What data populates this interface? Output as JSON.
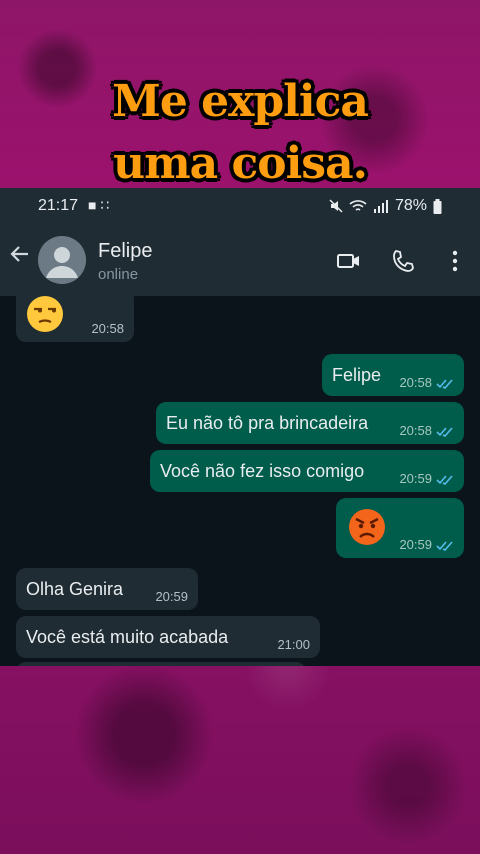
{
  "caption": {
    "line1": "Me explica",
    "line2": "uma coisa."
  },
  "statusbar": {
    "time": "21:17",
    "battery": "78%"
  },
  "header": {
    "name": "Felipe",
    "status": "online"
  },
  "messages": [
    {
      "dir": "in",
      "text": "",
      "emoji": "unamused-face",
      "time": "20:58"
    },
    {
      "dir": "out",
      "text": "Felipe",
      "time": "20:58",
      "read": true
    },
    {
      "dir": "out",
      "text": "Eu não tô pra brincadeira",
      "time": "20:58",
      "read": true
    },
    {
      "dir": "out",
      "text": "Você não fez isso comigo",
      "time": "20:59",
      "read": true
    },
    {
      "dir": "out",
      "text": "",
      "emoji": "angry-face",
      "time": "20:59",
      "read": true
    },
    {
      "dir": "in",
      "text": "Olha Genira",
      "time": "20:59"
    },
    {
      "dir": "in",
      "text": "Você está muito acabada",
      "time": "21:00"
    }
  ],
  "colors": {
    "tick_read": "#53bdeb",
    "bubble_out": "#005c4b",
    "bubble_in": "#1f2c34",
    "caption": "#ff9d10"
  }
}
